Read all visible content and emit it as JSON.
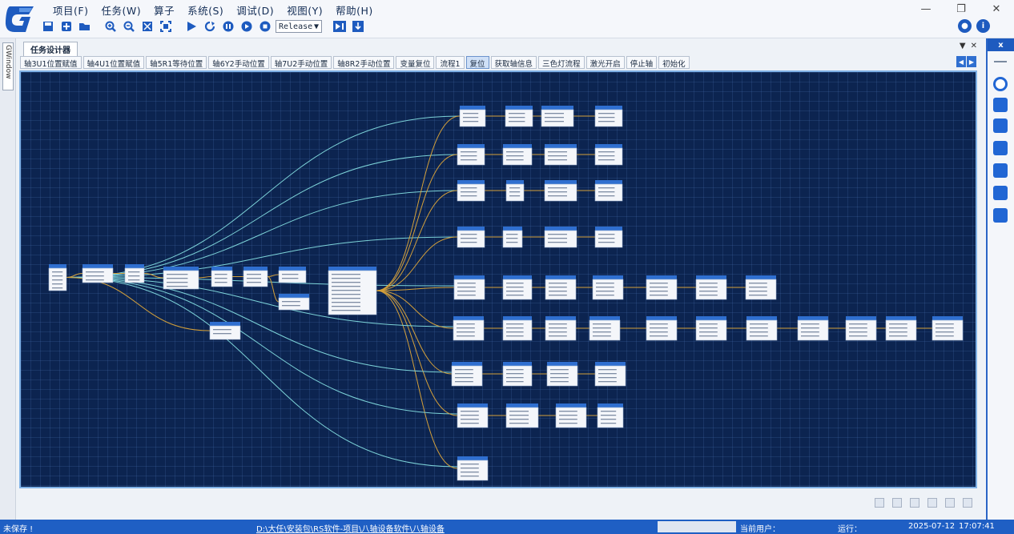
{
  "app": {
    "logo_letter": "G"
  },
  "menu": [
    "项目(F)",
    "任务(W)",
    "算子",
    "系统(S)",
    "调试(D)",
    "视图(Y)",
    "帮助(H)"
  ],
  "toolbar": {
    "config_value": "Release"
  },
  "left_dock": {
    "tab_label": "GWindow"
  },
  "document": {
    "tab_title": "任务设计器",
    "sub_tabs": [
      "轴3U1位置赋值",
      "轴4U1位置赋值",
      "轴5R1等待位置",
      "轴6Y2手动位置",
      "轴7U2手动位置",
      "轴8R2手动位置",
      "变量复位",
      "流程1",
      "复位",
      "获取轴信息",
      "三色灯流程",
      "激光开启",
      "停止轴",
      "初始化"
    ],
    "active_sub_tab": "复位"
  },
  "right_dock": {
    "close_label": "x"
  },
  "status": {
    "save_state": "未保存 !",
    "path": "D:\\大任\\安装包\\RS软件-项目\\八轴设备软件\\八轴设备",
    "current_user_label": "当前用户：",
    "run_label": "运行：",
    "date": "2025-07-12",
    "time": "17:07:41"
  },
  "colors": {
    "canvas_bg": "#0c2450",
    "node_header": "#2f6fd0",
    "link_gold": "#d4a03a",
    "link_cyan": "#7dd3d8",
    "accent": "#1f5fc4"
  }
}
